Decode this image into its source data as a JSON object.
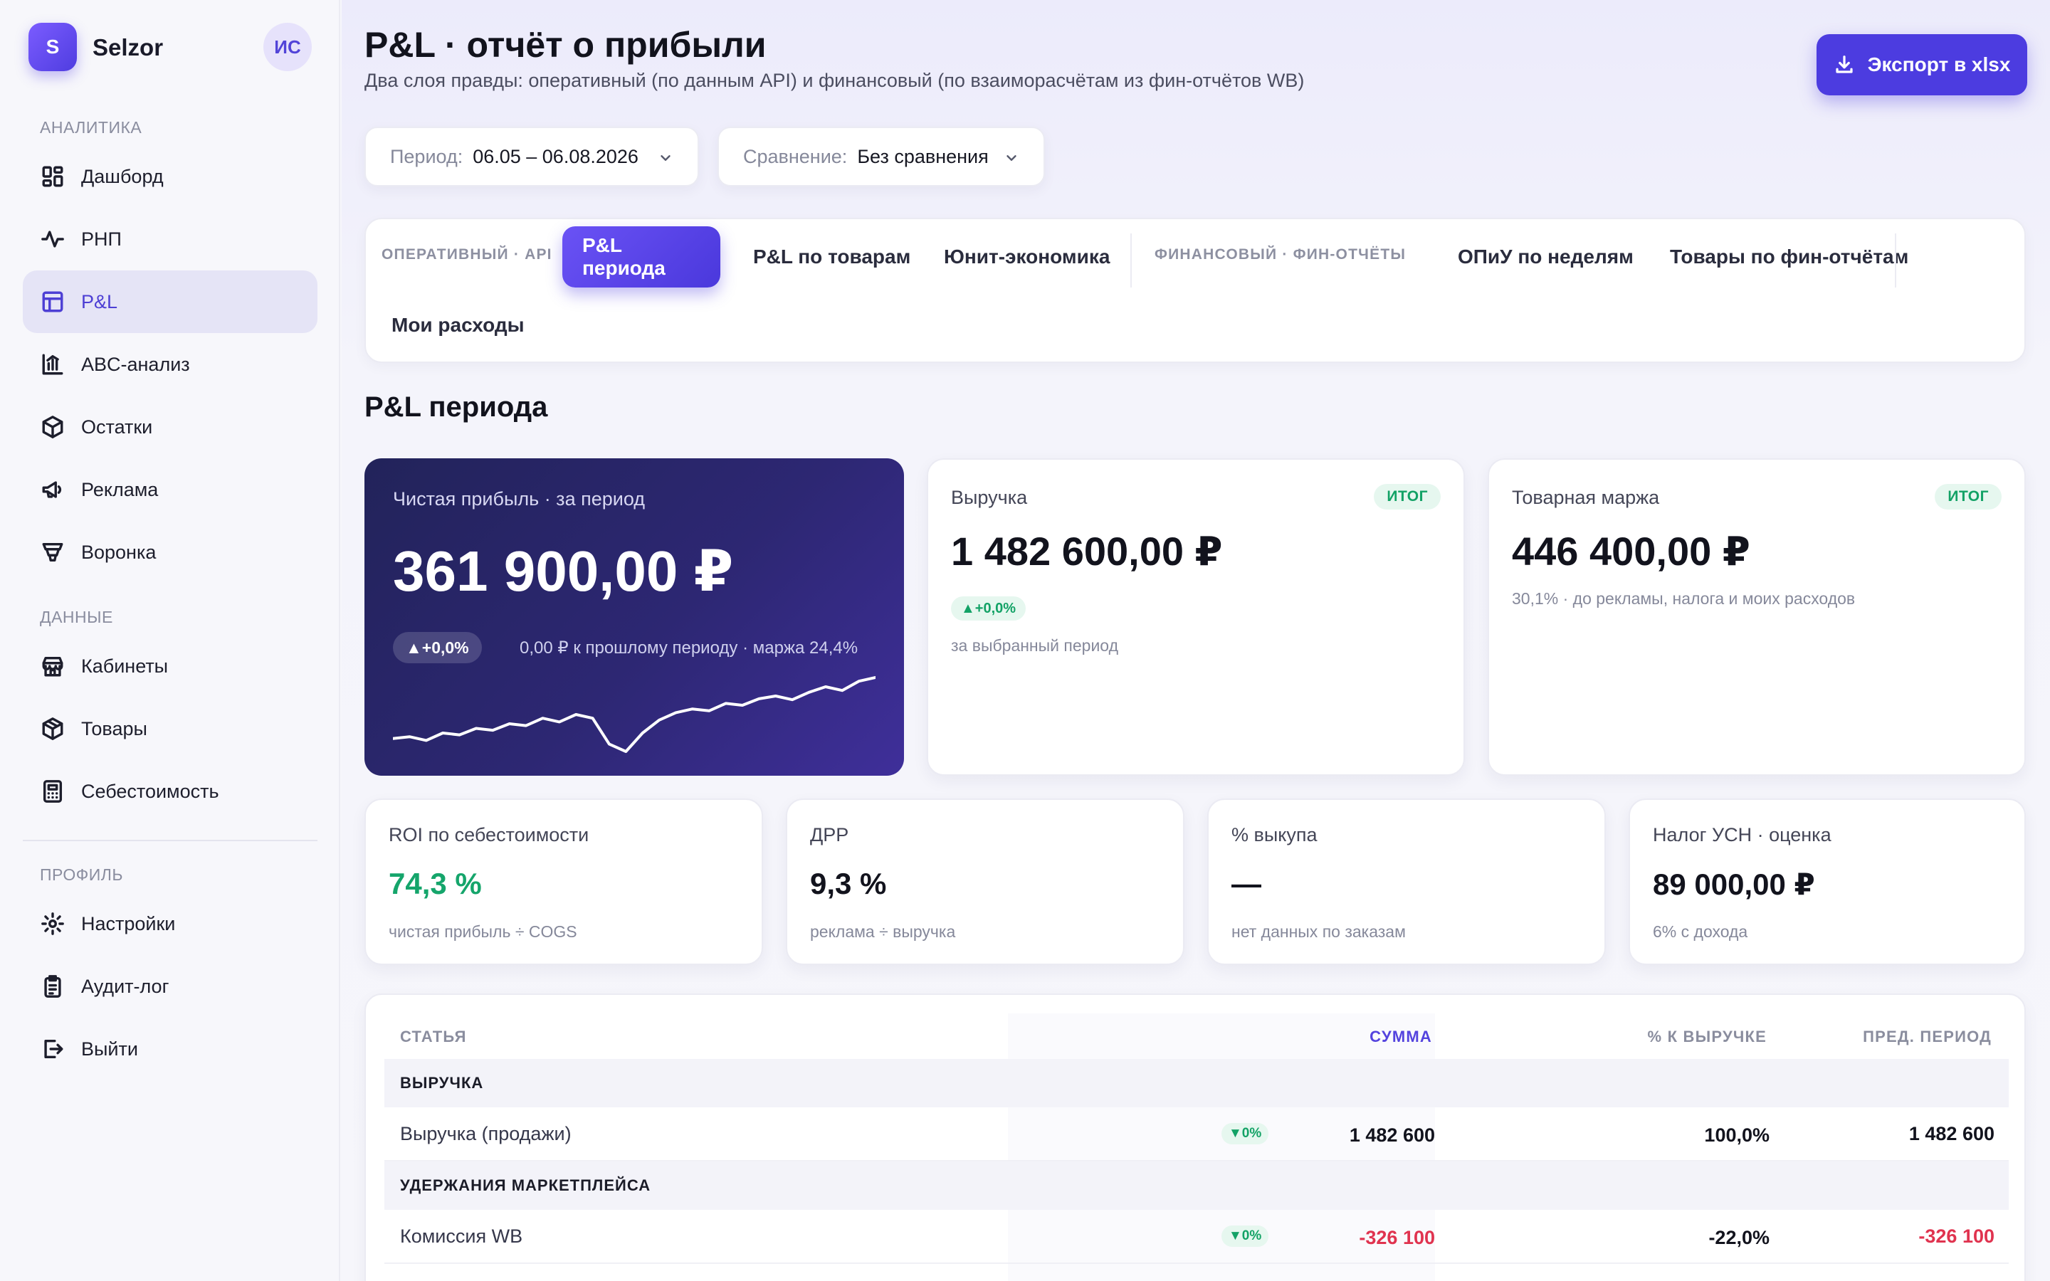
{
  "brand": {
    "logo_letter": "S",
    "name": "Selzor",
    "avatar": "ИС"
  },
  "sidebar": {
    "sections": [
      {
        "label": "АНАЛИТИКА"
      },
      {
        "label": "ДАННЫЕ"
      },
      {
        "label": "ПРОФИЛЬ"
      }
    ],
    "items": [
      {
        "label": "Дашборд",
        "icon": "dashboard-icon"
      },
      {
        "label": "РНП",
        "icon": "pulse-icon"
      },
      {
        "label": "P&L",
        "icon": "table-icon",
        "active": true
      },
      {
        "label": "ABC-анализ",
        "icon": "bar-chart-icon"
      },
      {
        "label": "Остатки",
        "icon": "box-icon"
      },
      {
        "label": "Реклама",
        "icon": "megaphone-icon"
      },
      {
        "label": "Воронка",
        "icon": "funnel-icon"
      },
      {
        "label": "Кабинеты",
        "icon": "store-icon"
      },
      {
        "label": "Товары",
        "icon": "package-icon"
      },
      {
        "label": "Себестоимость",
        "icon": "calculator-icon"
      },
      {
        "label": "Настройки",
        "icon": "gear-icon"
      },
      {
        "label": "Аудит-лог",
        "icon": "clipboard-icon"
      },
      {
        "label": "Выйти",
        "icon": "logout-icon"
      }
    ]
  },
  "header": {
    "title": "P&L · отчёт о прибыли",
    "subtitle": "Два слоя правды: оперативный (по данным API) и финансовый (по взаиморасчётам из фин-отчётов WB)",
    "export_label": "Экспорт в xlsx"
  },
  "filters": {
    "period_label": "Период:",
    "period_value": "06.05 – 06.08.2026",
    "compare_label": "Сравнение:",
    "compare_value": "Без сравнения"
  },
  "tabs": {
    "group_operational": "ОПЕРАТИВНЫЙ · API",
    "group_financial": "ФИНАНСОВЫЙ · ФИН-ОТЧЁТЫ",
    "items": [
      {
        "label": "P&L периода",
        "active": true
      },
      {
        "label": "P&L по товарам"
      },
      {
        "label": "Юнит-экономика"
      },
      {
        "label": "ОПиУ по неделям"
      },
      {
        "label": "Товары по фин-отчётам"
      },
      {
        "label": "Мои расходы"
      }
    ]
  },
  "section_title": "P&L периода",
  "hero": {
    "label": "Чистая прибыль · за период",
    "value": "361 900,00 ₽",
    "chip": "▲+0,0%",
    "note": "0,00 ₽ к прошлому периоду · маржа 24,4%",
    "sparkline": [
      22,
      24,
      20,
      28,
      26,
      33,
      31,
      38,
      36,
      44,
      40,
      48,
      44,
      16,
      8,
      28,
      42,
      50,
      54,
      52,
      60,
      58,
      65,
      68,
      64,
      72,
      78,
      74,
      84,
      88
    ]
  },
  "cards": {
    "revenue": {
      "label": "Выручка",
      "badge": "ИТОГ",
      "value": "1 482 600,00 ₽",
      "delta": "▲+0,0%",
      "note": "за выбранный период"
    },
    "margin": {
      "label": "Товарная маржа",
      "badge": "ИТОГ",
      "value": "446 400,00 ₽",
      "note": "30,1% · до рекламы, налога и моих расходов"
    },
    "roi": {
      "label": "ROI по себестоимости",
      "value": "74,3 %",
      "note": "чистая прибыль ÷ COGS"
    },
    "drr": {
      "label": "ДРР",
      "value": "9,3 %",
      "note": "реклама ÷ выручка"
    },
    "buyout": {
      "label": "% выкупа",
      "value": "—",
      "note": "нет данных по заказам"
    },
    "tax": {
      "label": "Налог УСН · оценка",
      "value": "89 000,00 ₽",
      "note": "6% с дохода"
    }
  },
  "table": {
    "headers": {
      "name": "СТАТЬЯ",
      "sum": "СУММА",
      "pct": "% К ВЫРУЧКЕ",
      "prev": "ПРЕД. ПЕРИОД"
    },
    "groups": [
      {
        "title": "ВЫРУЧКА",
        "rows": [
          {
            "name": "Выручка (продажи)",
            "chip": "▼0%",
            "sum": "1 482 600",
            "pct": "100,0%",
            "prev": "1 482 600"
          }
        ]
      },
      {
        "title": "УДЕРЖАНИЯ МАРКЕТПЛЕЙСА",
        "rows": [
          {
            "name": "Комиссия WB",
            "chip": "▼0%",
            "sum": "-326 100",
            "pct": "-22,0%",
            "prev": "-326 100"
          }
        ]
      }
    ]
  }
}
